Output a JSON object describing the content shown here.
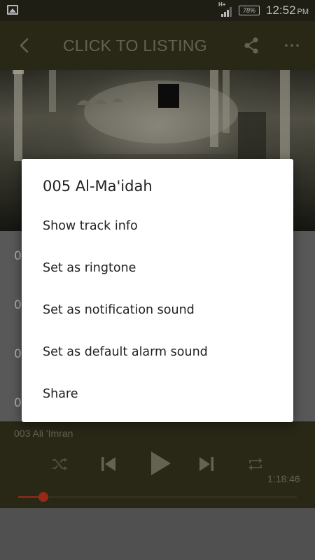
{
  "status_bar": {
    "network_type": "H+",
    "battery": "78%",
    "time": "12:52",
    "ampm": "PM"
  },
  "app_bar": {
    "title": "CLICK TO LISTING"
  },
  "list": {
    "rows": [
      "0",
      "0",
      "0",
      "0"
    ]
  },
  "player": {
    "now_playing": "003 Ali 'Imran",
    "duration": "1:18:46",
    "progress": 0.09
  },
  "dialog": {
    "title": "005 Al-Ma'idah",
    "items": [
      "Show track info",
      "Set as ringtone",
      "Set as notification sound",
      "Set as default alarm sound",
      "Share"
    ]
  },
  "colors": {
    "app_bar": "#39371f",
    "accent": "#d13a1f",
    "muted_text": "#8b8a74"
  }
}
